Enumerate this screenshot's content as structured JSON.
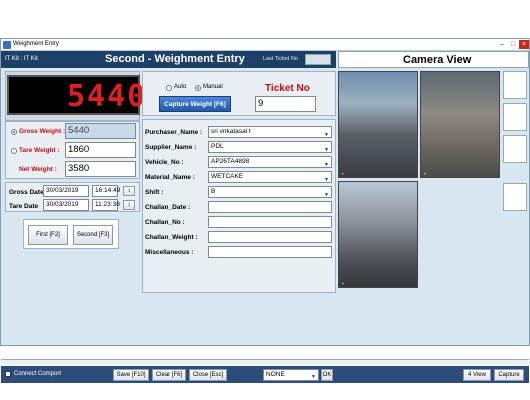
{
  "window": {
    "title": "Weighment Entry"
  },
  "header": {
    "company": "IT Kit : IT Kit",
    "title": "Second - Weighment Entry",
    "last_ticket_label": "Last Ticket No",
    "camera_title": "Camera View"
  },
  "display": {
    "reading": "5440"
  },
  "mode": {
    "auto_label": "Auto",
    "manual_label": "Manual",
    "selected": "Manual"
  },
  "ticket": {
    "label": "Ticket No",
    "capture_label": "Capture Weight [F6]",
    "value": "9"
  },
  "weights": {
    "gross_label": "Gross Weight :",
    "gross_value": "5440",
    "tare_label": "Tare Weight :",
    "tare_value": "1860",
    "net_label": "Net Weight :",
    "net_value": "3580"
  },
  "dates": {
    "gross_label": "Gross Date",
    "gross_date": "30/03/2019",
    "gross_time": "16:14:49",
    "tare_label": "Tare Date",
    "tare_date": "30/03/2019",
    "tare_time": "11:23:38"
  },
  "buttons": {
    "first": "First [F2]",
    "second": "Second [F3]"
  },
  "form": [
    {
      "label": "Purchaser_Name :",
      "value": "sri vnkatasai t",
      "dropdown": true
    },
    {
      "label": "Supplier_Name :",
      "value": "PDL",
      "dropdown": true
    },
    {
      "label": "Vehicle_No :",
      "value": "AP26TA4898",
      "dropdown": true
    },
    {
      "label": "Material_Name :",
      "value": "WETCAKE",
      "dropdown": true
    },
    {
      "label": "Shift :",
      "value": "B",
      "dropdown": true
    },
    {
      "label": "Challan_Date :",
      "value": "",
      "dropdown": false
    },
    {
      "label": "Challan_No :",
      "value": "",
      "dropdown": false
    },
    {
      "label": "Challan_Weight :",
      "value": "",
      "dropdown": false
    },
    {
      "label": "Miscellaneous :",
      "value": "",
      "dropdown": false
    }
  ],
  "footer": {
    "connect_label": "Connect Comport",
    "save": "Save [F10]",
    "clear": "Clear [F6]",
    "close": "Close [Esc]",
    "printer_value": "NONE",
    "ok": "OK",
    "view4": "4 View",
    "capture": "Capture"
  },
  "colors": {
    "header_bg": "#1e3f66",
    "display_red": "#e02020",
    "accent_red": "#c01010"
  }
}
